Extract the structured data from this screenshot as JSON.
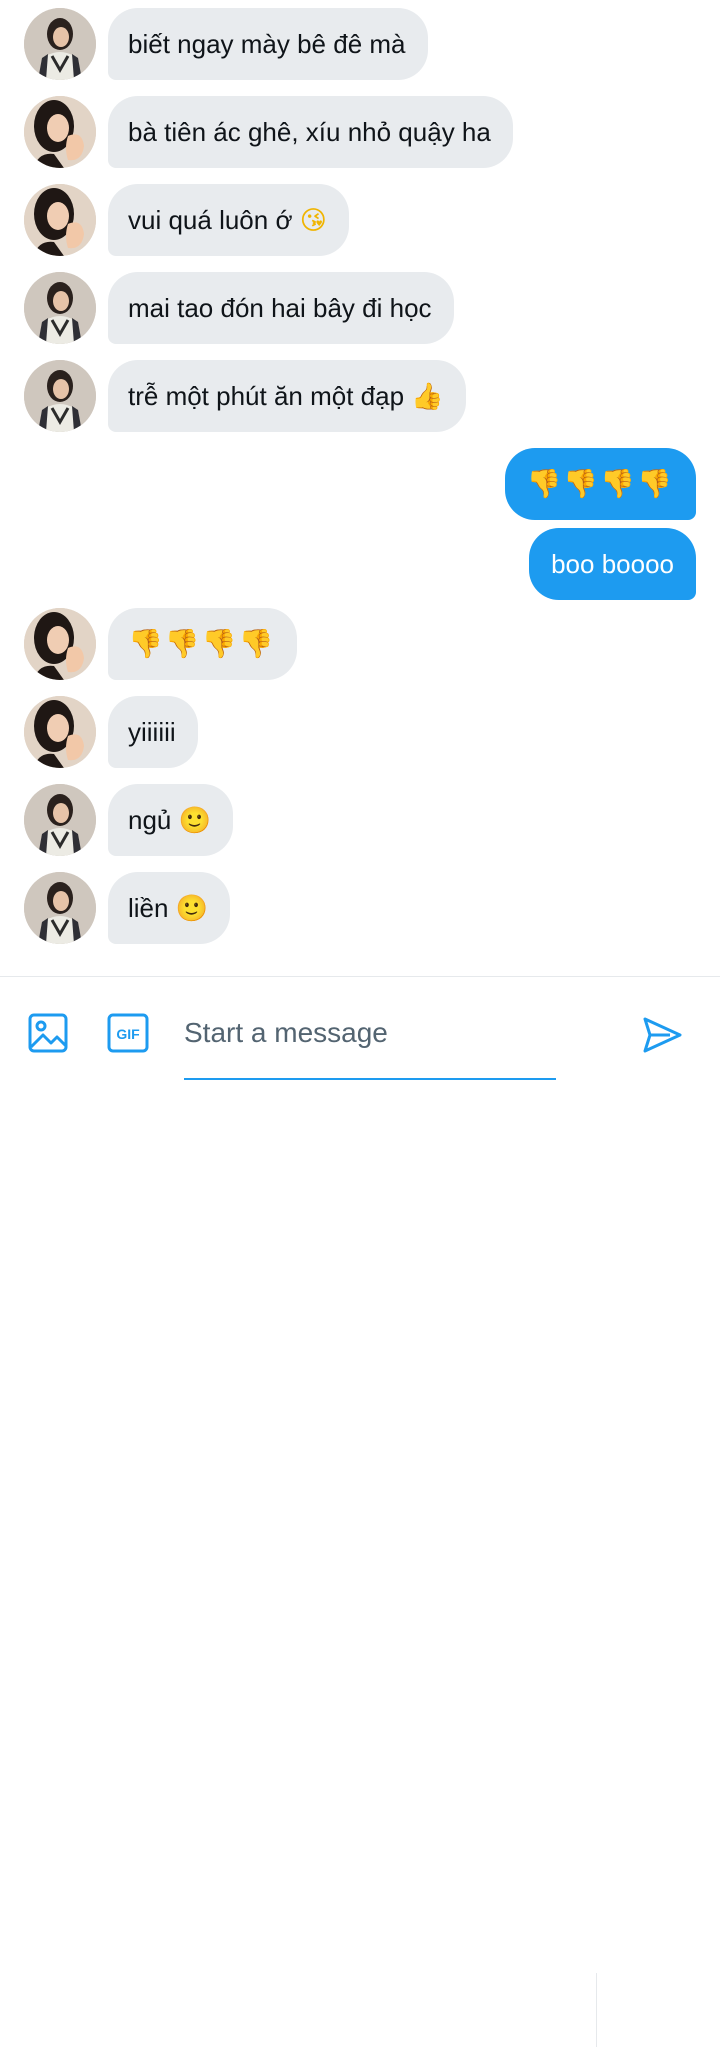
{
  "messages": [
    {
      "side": "in",
      "avatar": "a",
      "text": "biết ngay mày bê đê mà"
    },
    {
      "side": "in",
      "avatar": "b",
      "text": "bà tiên ác ghê, xíu nhỏ quậy ha"
    },
    {
      "side": "in",
      "avatar": "b",
      "text": "vui quá luôn ớ",
      "emoji": "😘"
    },
    {
      "side": "in",
      "avatar": "a",
      "text": "mai tao đón hai bây đi học"
    },
    {
      "side": "in",
      "avatar": "a",
      "text": "trễ một phút ăn một đạp",
      "emoji": "👍"
    },
    {
      "side": "out",
      "text": "",
      "emoji": "👎👎👎👎"
    },
    {
      "side": "out",
      "text": "boo boooo"
    },
    {
      "side": "in",
      "avatar": "b",
      "text": "",
      "emoji": "👎👎👎👎"
    },
    {
      "side": "in",
      "avatar": "b",
      "text": "yiiiiii"
    },
    {
      "side": "in",
      "avatar": "a",
      "text": "ngủ",
      "emoji": "🙂"
    },
    {
      "side": "in",
      "avatar": "a",
      "text": "liền",
      "emoji": "🙂"
    }
  ],
  "composer": {
    "placeholder": "Start a message",
    "media_icon": "image-icon",
    "gif_label": "GIF",
    "send_icon": "send-icon"
  },
  "colors": {
    "accent": "#1d9bf0",
    "incoming_bubble": "#e8ebee",
    "text": "#0f1419",
    "placeholder": "#536471"
  }
}
